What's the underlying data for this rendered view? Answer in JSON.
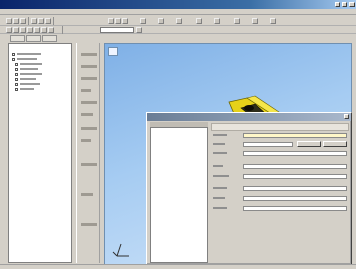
{
  "app": {
    "title": "",
    "accent": "#0a246a",
    "viewport_color": "#a6ccf2"
  },
  "menubar": {
    "items": []
  },
  "model_tree": {
    "items": []
  },
  "dialog": {
    "title": "",
    "header": "",
    "fields": []
  },
  "icons": {
    "tree_node": "tree-node-icon",
    "window_close": "close-icon",
    "axis_triad": "axis-triad-icon"
  }
}
